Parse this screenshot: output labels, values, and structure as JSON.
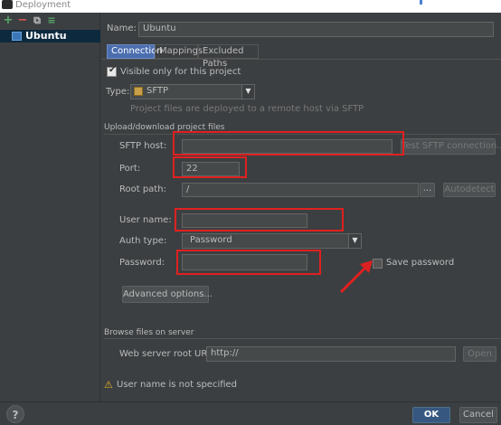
{
  "window": {
    "title": "Deployment"
  },
  "toolbar": {
    "add": "+",
    "remove": "−",
    "copy": "⧉",
    "move": "≡"
  },
  "sidebar": {
    "server_name": "Ubuntu"
  },
  "form": {
    "name_label": "Name:",
    "name_value": "Ubuntu",
    "tabs": [
      {
        "label": "Connection",
        "active": true
      },
      {
        "label": "Mappings",
        "active": false
      },
      {
        "label": "Excluded Paths",
        "active": false
      }
    ],
    "visible_only_label": "Visible only for this project",
    "visible_only_checked": true,
    "type_label": "Type:",
    "type_value": "SFTP",
    "type_hint": "Project files are deployed to a remote host via SFTP",
    "section_upload": "Upload/download project files",
    "sftp_host_label": "SFTP host:",
    "sftp_host_value": "",
    "test_button": "Test SFTP connection...",
    "port_label": "Port:",
    "port_value": "22",
    "root_path_label": "Root path:",
    "root_path_value": "/",
    "browse_button": "...",
    "autodetect_button": "Autodetect",
    "user_name_label": "User name:",
    "user_name_value": "",
    "auth_type_label": "Auth type:",
    "auth_type_value": "Password",
    "password_label": "Password:",
    "password_value": "",
    "save_password_label": "Save password",
    "save_password_checked": false,
    "advanced_button": "Advanced options...",
    "section_browse": "Browse files on server",
    "web_root_label": "Web server root URL:",
    "web_root_value": "http://",
    "open_button": "Open",
    "warning_text": "User name is not specified"
  },
  "footer": {
    "help": "?",
    "ok": "OK",
    "cancel": "Cancel"
  },
  "colors": {
    "background": "#3c3f41",
    "accent": "#4b6eaf",
    "selection": "#0d293e",
    "highlight_annotation": "#e02020"
  }
}
